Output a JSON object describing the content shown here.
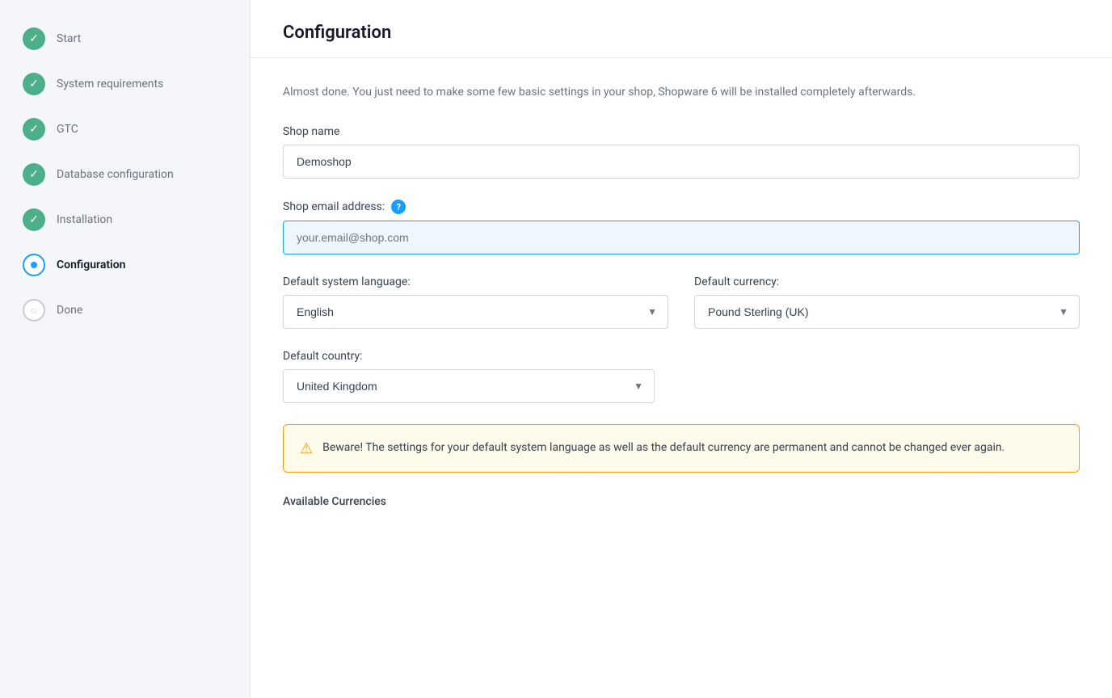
{
  "sidebar": {
    "items": [
      {
        "id": "start",
        "label": "Start",
        "status": "done"
      },
      {
        "id": "system-requirements",
        "label": "System requirements",
        "status": "done"
      },
      {
        "id": "gtc",
        "label": "GTC",
        "status": "done"
      },
      {
        "id": "database-configuration",
        "label": "Database configuration",
        "status": "done"
      },
      {
        "id": "installation",
        "label": "Installation",
        "status": "done"
      },
      {
        "id": "configuration",
        "label": "Configuration",
        "status": "current"
      },
      {
        "id": "done",
        "label": "Done",
        "status": "pending"
      }
    ]
  },
  "main": {
    "title": "Configuration",
    "intro": "Almost done. You just need to make some few basic settings in your shop, Shopware 6 will be installed completely afterwards.",
    "shop_name_label": "Shop name",
    "shop_name_value": "Demoshop",
    "shop_email_label": "Shop email address:",
    "shop_email_placeholder": "your.email@shop.com",
    "default_language_label": "Default system language:",
    "default_language_value": "English",
    "default_currency_label": "Default currency:",
    "default_currency_value": "Pound Sterling (UK)",
    "default_country_label": "Default country:",
    "default_country_value": "United Kingdom",
    "warning_text": "Beware! The settings for your default system language as well as the default currency are permanent and cannot be changed ever again.",
    "available_currencies_label": "Available Currencies",
    "help_icon_label": "?"
  }
}
